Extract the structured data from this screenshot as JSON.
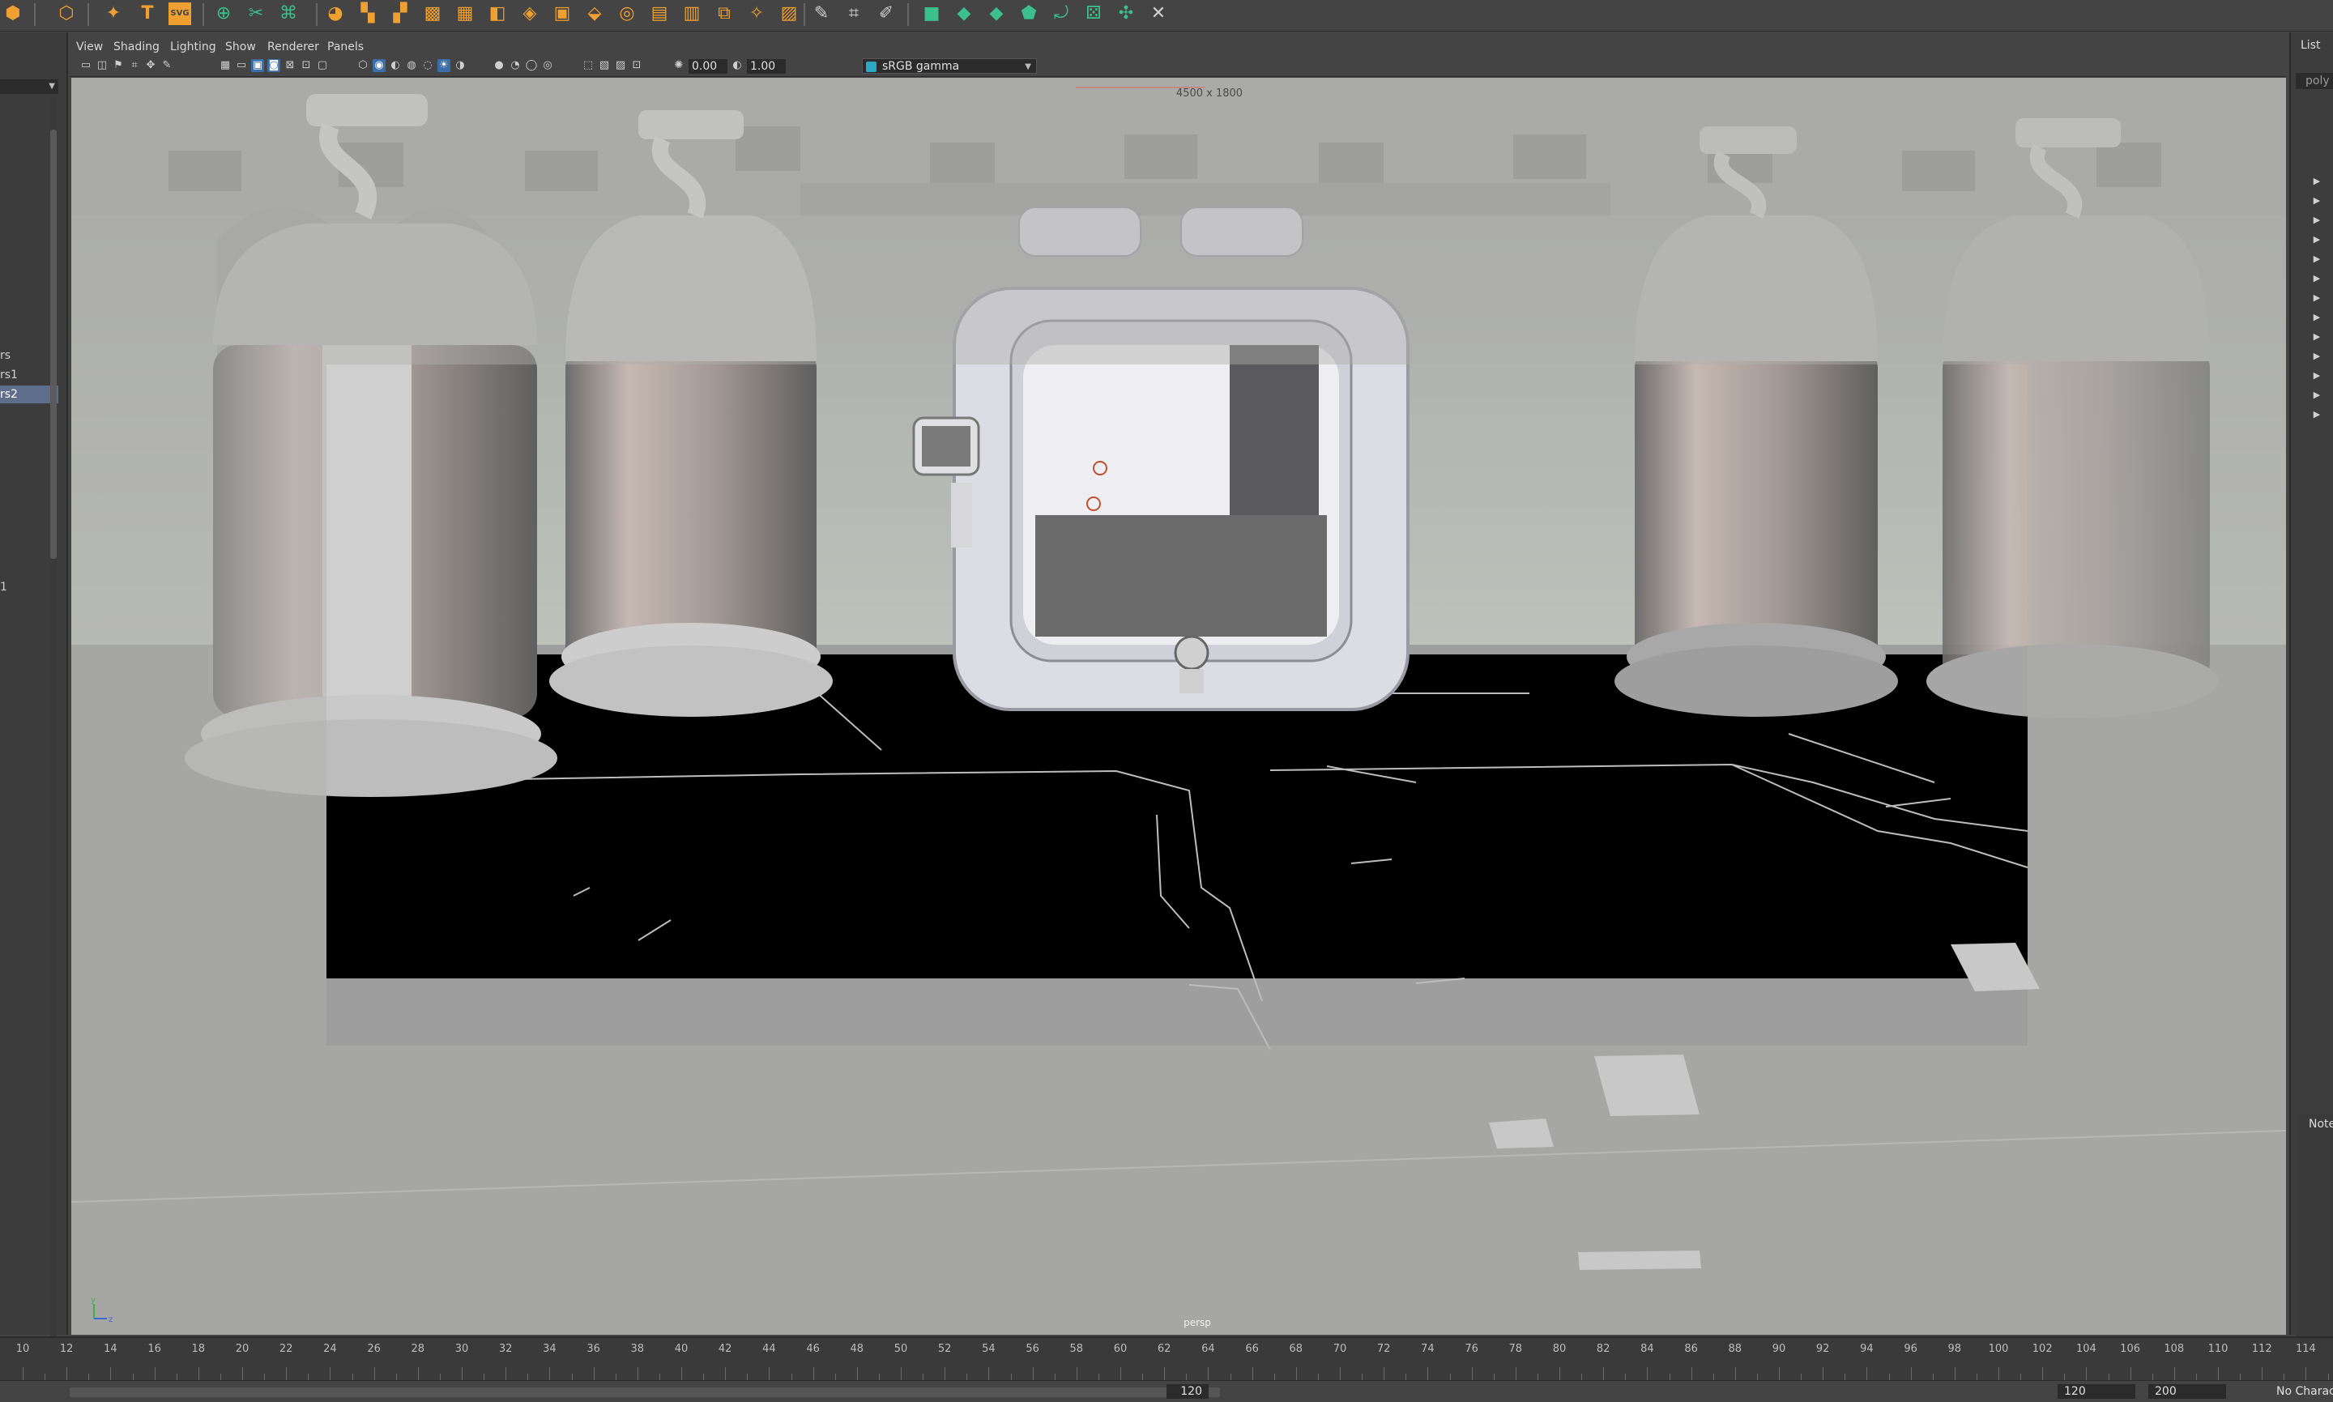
{
  "viewport": {
    "menus": [
      "View",
      "Shading",
      "Lighting",
      "Show",
      "Renderer",
      "Panels"
    ],
    "near_clip_value": "0.00",
    "gamma_value": "1.00",
    "color_space": "sRGB gamma",
    "resolution_label": "4500 x 1800",
    "camera_name": "persp",
    "axis_y": "y",
    "axis_z": "z"
  },
  "outliner": {
    "rows": [
      "rs",
      "rs1",
      "rs2",
      "1"
    ],
    "selected_index": 2
  },
  "right_panel": {
    "list_label": "List",
    "field_value": "poly",
    "notes_label": "Note"
  },
  "timeline": {
    "ticks": [
      "10",
      "12",
      "14",
      "16",
      "18",
      "20",
      "22",
      "24",
      "26",
      "28",
      "30",
      "32",
      "34",
      "36",
      "38",
      "40",
      "42",
      "44",
      "46",
      "48",
      "50",
      "52",
      "54",
      "56",
      "58",
      "60",
      "62",
      "64",
      "66",
      "68",
      "70",
      "72",
      "74",
      "76",
      "78",
      "80",
      "82",
      "84",
      "86",
      "88",
      "90",
      "92",
      "94",
      "96",
      "98",
      "100",
      "102",
      "104",
      "106",
      "108",
      "110",
      "112",
      "114"
    ],
    "current_frame": "120",
    "range_end": "120",
    "animation_end": "200",
    "character_set": "No Charac"
  },
  "colors": {
    "accent_orange": "#f0a030",
    "accent_green": "#3bbf8f",
    "selection_blue": "#5d6d8a",
    "toolbar_active": "#3b6ea8"
  }
}
